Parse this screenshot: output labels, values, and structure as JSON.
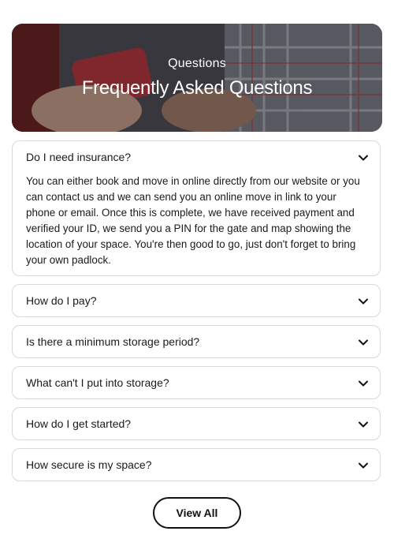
{
  "hero": {
    "eyebrow": "Questions",
    "title": "Frequently Asked Questions"
  },
  "faq": [
    {
      "question": "Do I need insurance?",
      "expanded": true,
      "answer": "You can either book and move in online directly from our website or you can contact us and we can send you an online move in link to your phone or email. Once this is complete, we have received payment and verified your ID, we send you a PIN for the gate and map showing the location of your space. You're then good to go, just don't forget to bring your own padlock."
    },
    {
      "question": "How do I pay?",
      "expanded": false
    },
    {
      "question": "Is there a minimum storage period?",
      "expanded": false
    },
    {
      "question": "What can't I put into storage?",
      "expanded": false
    },
    {
      "question": "How do I get started?",
      "expanded": false
    },
    {
      "question": "How secure is my space?",
      "expanded": false
    }
  ],
  "view_all_label": "View All",
  "icons": {
    "toggle": "chevron-down-icon"
  },
  "colors": {
    "border": "#d9d9d9",
    "text": "#1a1a1a",
    "button_border": "#111111"
  }
}
